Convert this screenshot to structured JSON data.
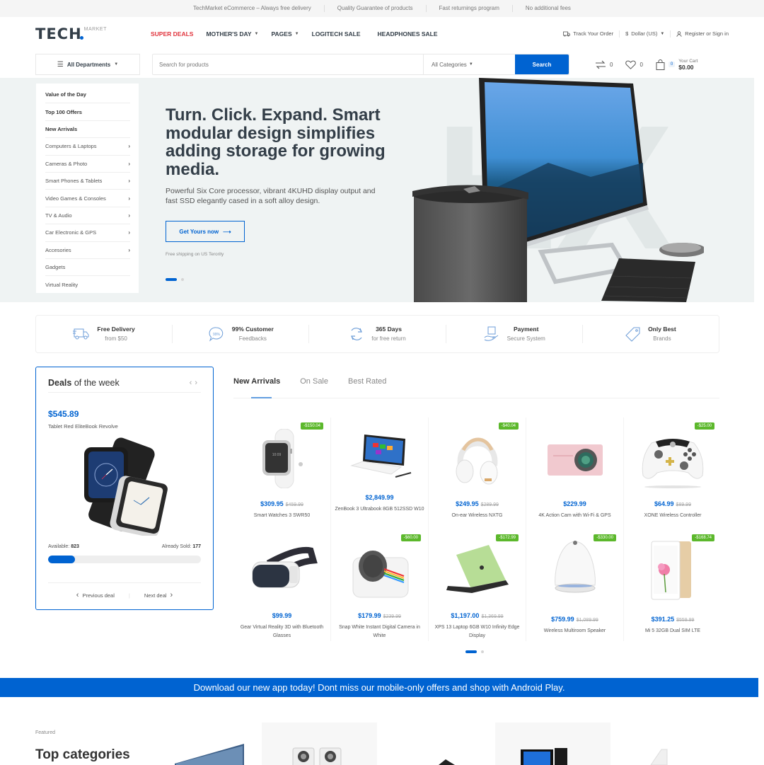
{
  "topbar": [
    "TechMarket eCommerce – Always free delivery",
    "Quality Guarantee of products",
    "Fast returnings program",
    "No additional fees"
  ],
  "logo": {
    "main": "TECH",
    "sub": "MARKET"
  },
  "nav": [
    {
      "label": "SUPER DEALS",
      "hot": true
    },
    {
      "label": "MOTHER'S DAY",
      "dropdown": true
    },
    {
      "label": "PAGES",
      "dropdown": true
    },
    {
      "label": "LOGITECH SALE"
    },
    {
      "label": "HEADPHONES SALE"
    }
  ],
  "header_right": {
    "track": "Track Your Order",
    "currency": "Dollar (US)",
    "account": "Register or Sign in"
  },
  "search": {
    "all_departments": "All Departments",
    "placeholder": "Search for products",
    "category": "All Categories",
    "button": "Search"
  },
  "header_icons": {
    "compare_count": "0",
    "wishlist_count": "0",
    "cart_count": "0",
    "cart_label": "Your Cart",
    "cart_total": "$0.00"
  },
  "dept_menu": [
    {
      "label": "Value of the Day",
      "bold": true
    },
    {
      "label": "Top 100 Offers",
      "bold": true
    },
    {
      "label": "New Arrivals",
      "bold": true
    },
    {
      "label": "Computers & Laptops",
      "sub": true
    },
    {
      "label": "Cameras & Photo",
      "sub": true
    },
    {
      "label": "Smart Phones & Tablets",
      "sub": true
    },
    {
      "label": "Video Games & Consoles",
      "sub": true
    },
    {
      "label": "TV & Audio",
      "sub": true
    },
    {
      "label": "Car Electronic & GPS",
      "sub": true
    },
    {
      "label": "Accesories",
      "sub": true
    },
    {
      "label": "Gadgets"
    },
    {
      "label": "Virtual Reality"
    }
  ],
  "hero": {
    "title": "Turn. Click. Expand. Smart modular design simplifies adding storage for growing media.",
    "subtitle": "Powerful Six Core processor, vibrant 4KUHD display output and fast SSD elegantly cased in a soft alloy design.",
    "button": "Get Yours now",
    "shipping": "Free shipping on US Terority",
    "bg_text": "HX",
    "slides": 2,
    "active_slide": 1
  },
  "features": [
    {
      "icon": "truck-icon",
      "title": "Free Delivery",
      "sub": "from $50"
    },
    {
      "icon": "feedback-icon",
      "title": "99% Customer",
      "sub": "Feedbacks"
    },
    {
      "icon": "return-icon",
      "title": "365 Days",
      "sub": "for free return"
    },
    {
      "icon": "payment-icon",
      "title": "Payment",
      "sub": "Secure System"
    },
    {
      "icon": "tag-icon",
      "title": "Only Best",
      "sub": "Brands"
    }
  ],
  "deals": {
    "title_bold": "Deals",
    "title_rest": " of the week",
    "price": "$545.89",
    "name": "Tablet Red EliteBook Revolve",
    "available_label": "Available:",
    "available": "823",
    "sold_label": "Already Sold:",
    "sold": "177",
    "sold_fraction": 0.177,
    "prev": "Previous deal",
    "next": "Next deal"
  },
  "tabs": [
    {
      "label": "New Arrivals",
      "active": true
    },
    {
      "label": "On Sale"
    },
    {
      "label": "Best Rated"
    }
  ],
  "products": [
    {
      "name": "Smart Watches 3 SWR50",
      "price": "$309.95",
      "old": "$459.99",
      "badge": "-$150.04",
      "img": "watch"
    },
    {
      "name": "ZenBook 3 Ultrabook 8GB 512SSD W10",
      "price": "$2,849.99",
      "old": "",
      "badge": "",
      "img": "tablet"
    },
    {
      "name": "On-ear Wireless NXTG",
      "price": "$249.95",
      "old": "$289.99",
      "badge": "-$40.04",
      "img": "headphones"
    },
    {
      "name": "4K Action Cam with Wi-Fi & GPS",
      "price": "$229.99",
      "old": "",
      "badge": "",
      "img": "camera"
    },
    {
      "name": "XONE Wireless Controller",
      "price": "$64.99",
      "old": "$89.99",
      "badge": "-$25.00",
      "img": "controller"
    },
    {
      "name": "Gear Virtual Reality 3D with Bluetooth Glasses",
      "price": "$99.99",
      "old": "",
      "badge": "",
      "img": "vr"
    },
    {
      "name": "Snap White Instant Digital Camera in White",
      "price": "$179.99",
      "old": "$239.99",
      "badge": "-$60.00",
      "img": "instant"
    },
    {
      "name": "XPS 13 Laptop 6GB W10 Infinity Edge Display",
      "price": "$1,197.00",
      "old": "$1,369.99",
      "badge": "-$172.99",
      "img": "laptop"
    },
    {
      "name": "Wireless Multiroom Speaker",
      "price": "$759.99",
      "old": "$1,089.99",
      "badge": "-$330.00",
      "img": "speaker"
    },
    {
      "name": "Mi 5 32GB Dual SIM LTE",
      "price": "$391.25",
      "old": "$559.99",
      "badge": "-$168.74",
      "img": "phone"
    }
  ],
  "grid_pages": 2,
  "app_banner": "Download our new app today! Dont miss our mobile-only offers and shop with Android Play.",
  "featured": {
    "label": "Featured",
    "title": "Top categories"
  },
  "colors": {
    "accent": "#0063d1",
    "hot": "#e1343d",
    "badge": "#5cb82c"
  }
}
